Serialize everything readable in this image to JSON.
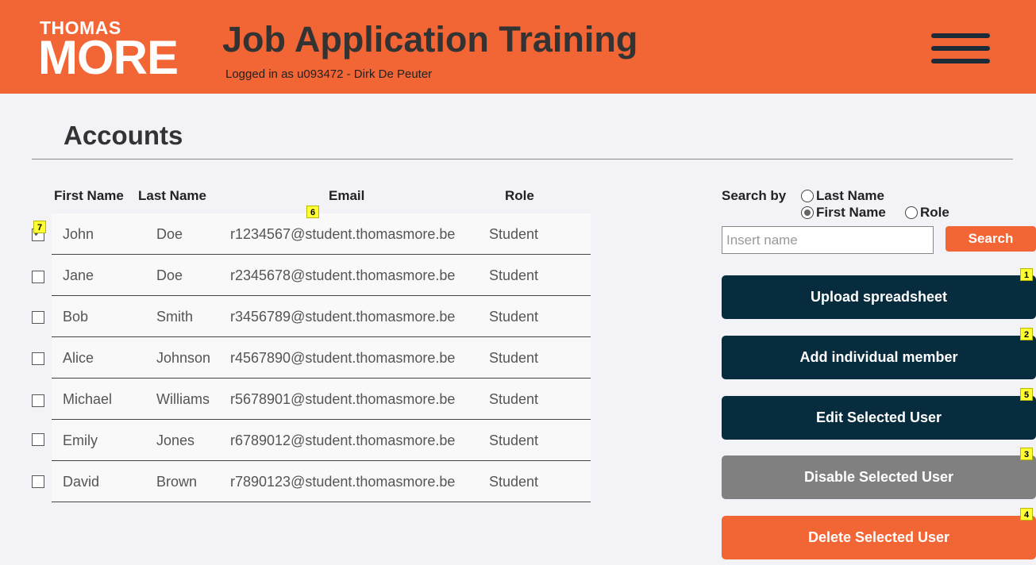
{
  "header": {
    "logo_top": "THOMAS",
    "logo_bottom": "MORE",
    "app_title": "Job Application Training",
    "login_info": "Logged in as u093472 - Dirk De Peuter",
    "menu_icon": "hamburger-menu-icon"
  },
  "page": {
    "title": "Accounts"
  },
  "table": {
    "headers": {
      "first_name": "First Name",
      "last_name": "Last Name",
      "email": "Email",
      "role": "Role"
    },
    "rows": [
      {
        "checked": true,
        "first": "John",
        "last": "Doe",
        "email": "r1234567@student.thomasmore.be",
        "role": "Student"
      },
      {
        "checked": false,
        "first": "Jane",
        "last": "Doe",
        "email": "r2345678@student.thomasmore.be",
        "role": "Student"
      },
      {
        "checked": false,
        "first": "Bob",
        "last": "Smith",
        "email": "r3456789@student.thomasmore.be",
        "role": "Student"
      },
      {
        "checked": false,
        "first": "Alice",
        "last": "Johnson",
        "email": "r4567890@student.thomasmore.be",
        "role": "Student"
      },
      {
        "checked": false,
        "first": "Michael",
        "last": "Williams",
        "email": "r5678901@student.thomasmore.be",
        "role": "Student"
      },
      {
        "checked": false,
        "first": "Emily",
        "last": "Jones",
        "email": "r6789012@student.thomasmore.be",
        "role": "Student"
      },
      {
        "checked": false,
        "first": "David",
        "last": "Brown",
        "email": "r7890123@student.thomasmore.be",
        "role": "Student"
      }
    ]
  },
  "search": {
    "label": "Search by",
    "options": {
      "last_name": "Last Name",
      "first_name": "First Name",
      "role": "Role"
    },
    "selected": "first_name",
    "placeholder": "Insert name",
    "value": "",
    "button": "Search"
  },
  "actions": {
    "upload": "Upload spreadsheet",
    "add": "Add individual member",
    "edit": "Edit Selected User",
    "disable": "Disable Selected User",
    "delete": "Delete Selected User"
  },
  "badges": {
    "upload": "1",
    "add": "2",
    "disable": "3",
    "delete": "4",
    "edit": "5",
    "email": "6",
    "checkbox": "7"
  },
  "colors": {
    "brand_orange": "#f26535",
    "dark_navy": "#062c3d",
    "disabled_grey": "#808080",
    "badge_yellow": "#ffff33"
  }
}
